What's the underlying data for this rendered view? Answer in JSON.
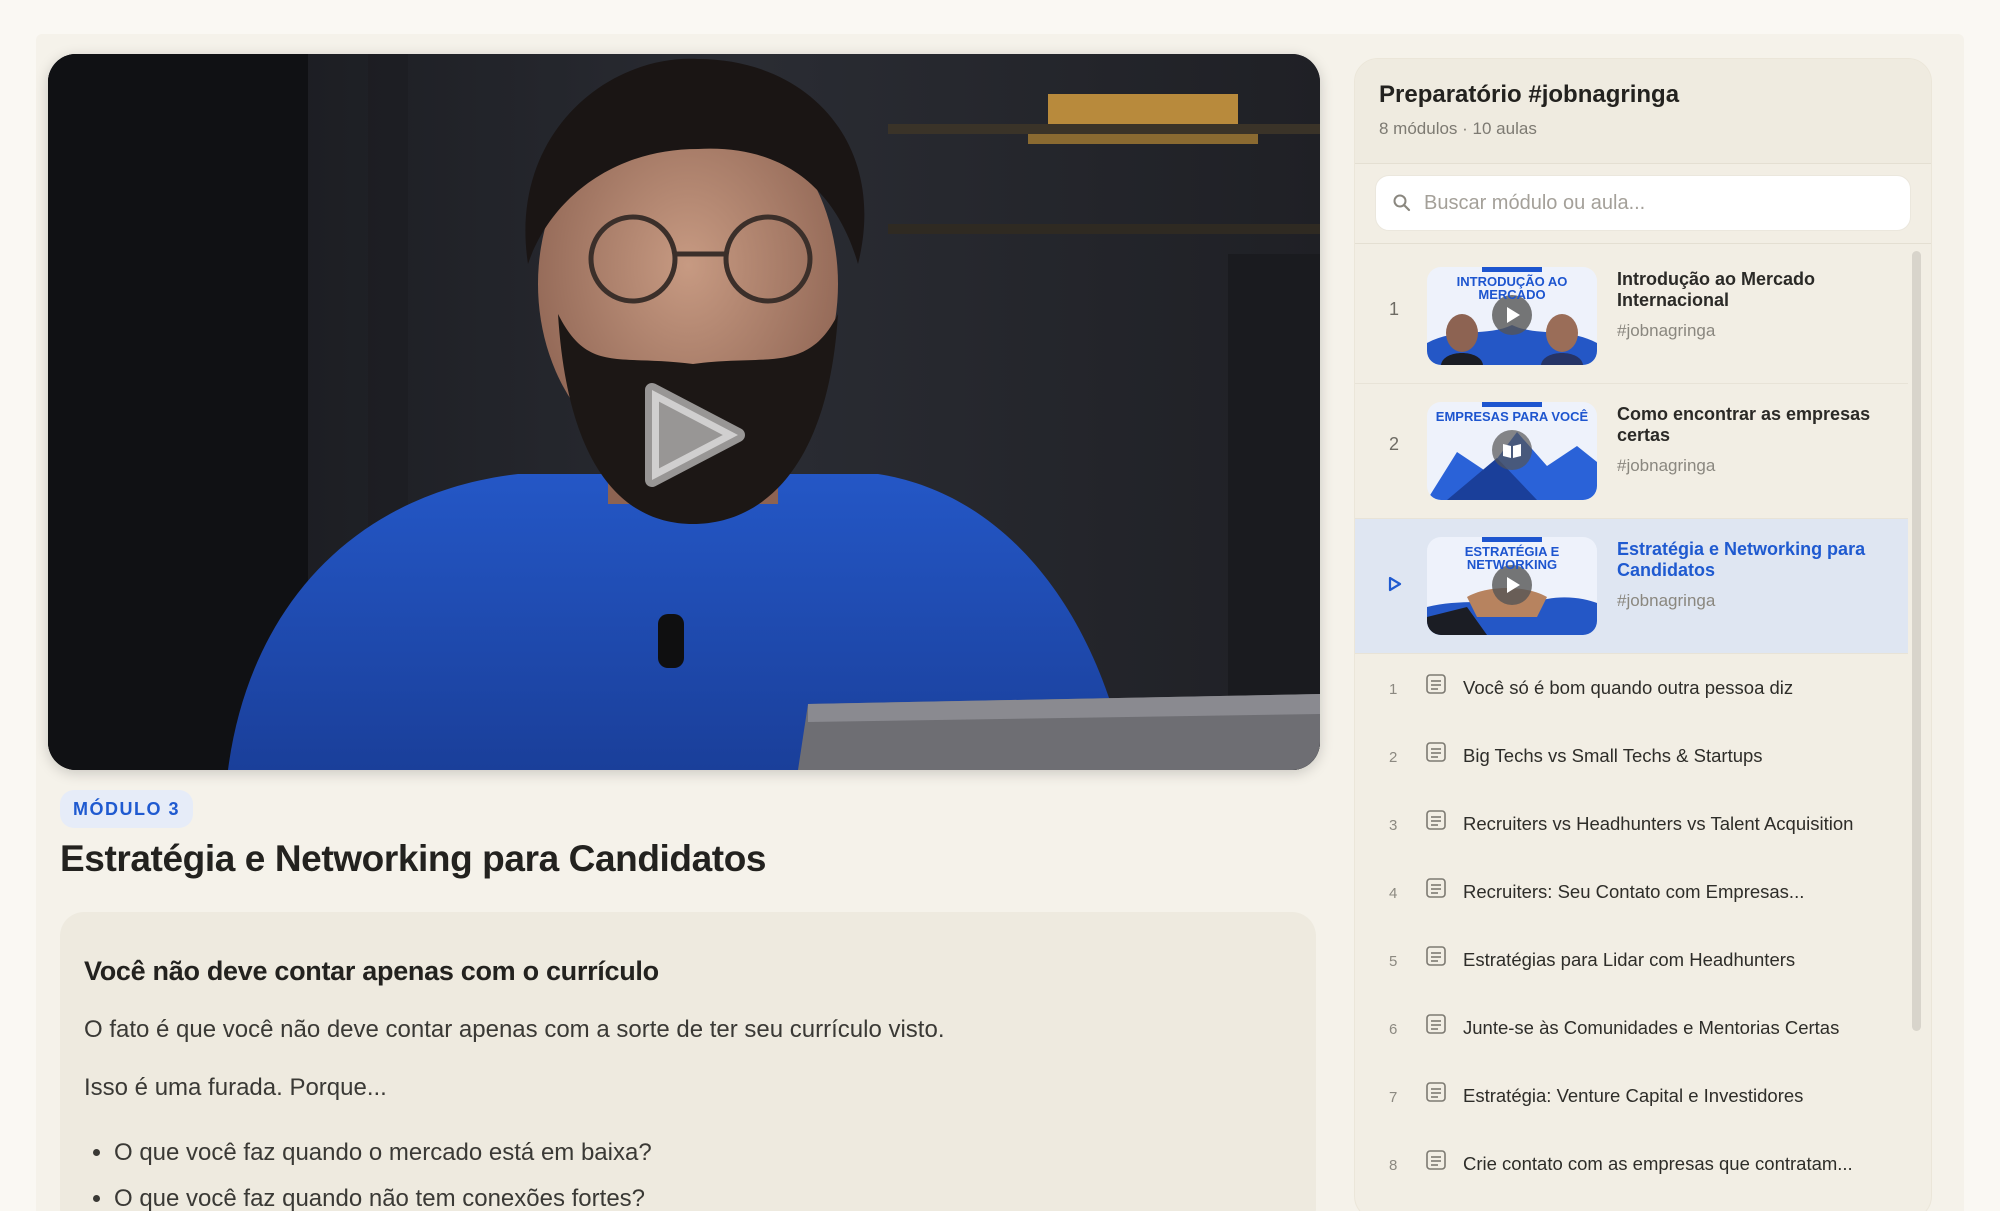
{
  "video": {
    "play_icon": "play-icon"
  },
  "module_badge": "MÓDULO 3",
  "lesson_title": "Estratégia e Networking para Candidatos",
  "content": {
    "heading": "Você não deve contar apenas com o currículo",
    "paragraphs": [
      "O fato é que você não deve contar apenas com a sorte de ter seu currículo visto.",
      "Isso é uma furada. Porque..."
    ],
    "bullets": [
      "O que você faz quando o mercado está em baixa?",
      "O que você faz quando não tem conexões fortes?"
    ]
  },
  "sidebar": {
    "title": "Preparatório #jobnagringa",
    "subtitle": "8 módulos · 10 aulas",
    "search_placeholder": "Buscar módulo ou aula...",
    "modules": [
      {
        "number": "1",
        "title": "Introdução ao Mercado Internacional",
        "tag": "#jobnagringa",
        "thumb_text": "INTRODUÇÃO AO MERCADO",
        "thumb_icon": "play-icon",
        "active": false
      },
      {
        "number": "2",
        "title": "Como encontrar as empresas certas",
        "tag": "#jobnagringa",
        "thumb_text": "EMPRESAS PARA VOCÊ",
        "thumb_icon": "book-icon",
        "active": false
      },
      {
        "number": "",
        "title": "Estratégia e Networking para Candidatos",
        "tag": "#jobnagringa",
        "thumb_text": "ESTRATÉGIA E NETWORKING",
        "thumb_icon": "play-icon",
        "active": true
      }
    ],
    "lessons": [
      {
        "number": "1",
        "title": "Você só é bom quando outra pessoa diz"
      },
      {
        "number": "2",
        "title": "Big Techs vs Small Techs & Startups"
      },
      {
        "number": "3",
        "title": "Recruiters vs Headhunters vs Talent Acquisition"
      },
      {
        "number": "4",
        "title": "Recruiters: Seu Contato com Empresas..."
      },
      {
        "number": "5",
        "title": "Estratégias para Lidar com Headhunters"
      },
      {
        "number": "6",
        "title": "Junte-se às Comunidades e Mentorias Certas"
      },
      {
        "number": "7",
        "title": "Estratégia: Venture Capital e Investidores"
      },
      {
        "number": "8",
        "title": "Crie contato com as empresas que contratam..."
      }
    ]
  },
  "colors": {
    "accent": "#1f5ad0",
    "active_bg": "#dfe6f2",
    "page_bg": "#f5f2ea"
  }
}
